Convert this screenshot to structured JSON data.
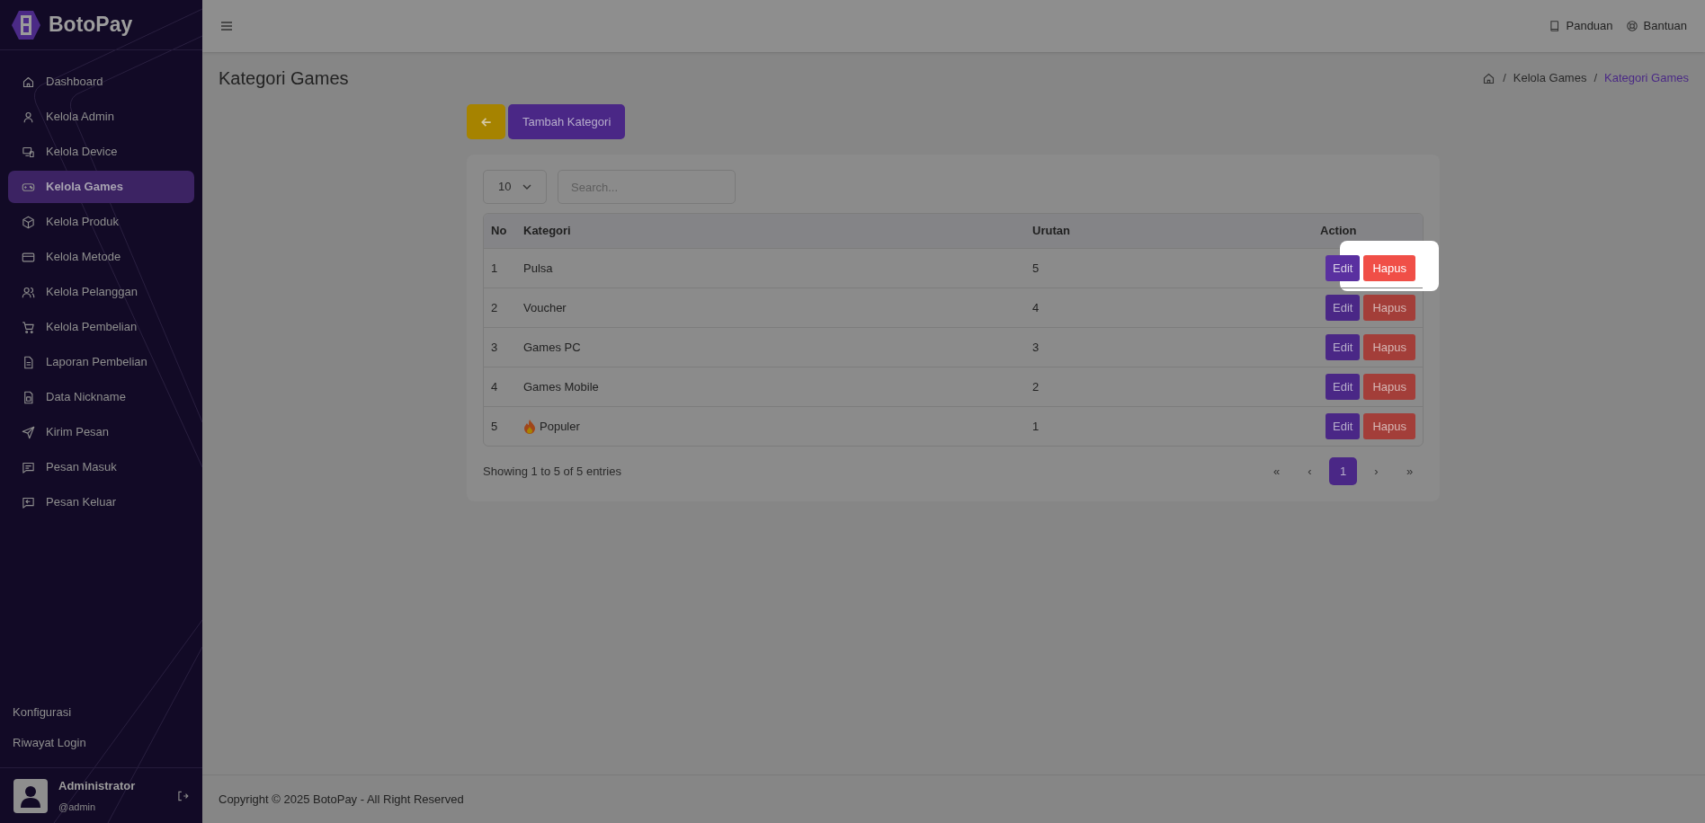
{
  "sidebar": {
    "brand": "BotoPay",
    "items": [
      {
        "label": "Dashboard",
        "selected": false
      },
      {
        "label": "Kelola Admin",
        "selected": false
      },
      {
        "label": "Kelola Device",
        "selected": false
      },
      {
        "label": "Kelola Games",
        "selected": true
      },
      {
        "label": "Kelola Produk",
        "selected": false
      },
      {
        "label": "Kelola Metode",
        "selected": false
      },
      {
        "label": "Kelola Pelanggan",
        "selected": false
      },
      {
        "label": "Kelola Pembelian",
        "selected": false
      },
      {
        "label": "Laporan Pembelian",
        "selected": false
      },
      {
        "label": "Data Nickname",
        "selected": false
      },
      {
        "label": "Kirim Pesan",
        "selected": false
      },
      {
        "label": "Pesan Masuk",
        "selected": false
      },
      {
        "label": "Pesan Keluar",
        "selected": false
      }
    ],
    "bottom_links": [
      "Konfigurasi",
      "Riwayat Login"
    ],
    "user": {
      "name": "Administrator",
      "handle": "@admin"
    }
  },
  "header": {
    "links": [
      "Panduan",
      "Bantuan"
    ]
  },
  "page": {
    "title": "Kategori Games",
    "breadcrumb": [
      {
        "separator": "/",
        "label": "Kelola Games",
        "current": false
      },
      {
        "separator": "/",
        "label": "Kategori Games",
        "current": true
      }
    ]
  },
  "actions": {
    "add_button": "Tambah Kategori"
  },
  "table": {
    "page_size": "10",
    "search": {
      "placeholder": "Search..."
    },
    "columns": [
      "No",
      "Kategori",
      "Urutan",
      "Action"
    ],
    "rows": [
      {
        "no": "1",
        "kategori": "Pulsa",
        "kind": "plain",
        "urutan": "5",
        "edit": "Edit",
        "delete": "Hapus",
        "tour_focus": true
      },
      {
        "no": "2",
        "kategori": "Voucher",
        "kind": "plain",
        "urutan": "4",
        "edit": "Edit",
        "delete": "Hapus",
        "tour_focus": false
      },
      {
        "no": "3",
        "kategori": "Games PC",
        "kind": "plain",
        "urutan": "3",
        "edit": "Edit",
        "delete": "Hapus",
        "tour_focus": false
      },
      {
        "no": "4",
        "kategori": "Games Mobile",
        "kind": "plain",
        "urutan": "2",
        "edit": "Edit",
        "delete": "Hapus",
        "tour_focus": false
      },
      {
        "no": "5",
        "kategori": "Populer",
        "kind": "featured",
        "urutan": "1",
        "edit": "Edit",
        "delete": "Hapus",
        "tour_focus": false
      }
    ],
    "info": "Showing 1 to 5 of 5 entries",
    "pagination": [
      {
        "label": "«",
        "selected": false
      },
      {
        "label": "‹",
        "selected": false
      },
      {
        "label": "1",
        "selected": true
      },
      {
        "label": "›",
        "selected": false
      },
      {
        "label": "»",
        "selected": false
      }
    ]
  },
  "footer": "Copyright © 2025 BotoPay - All Right Reserved"
}
